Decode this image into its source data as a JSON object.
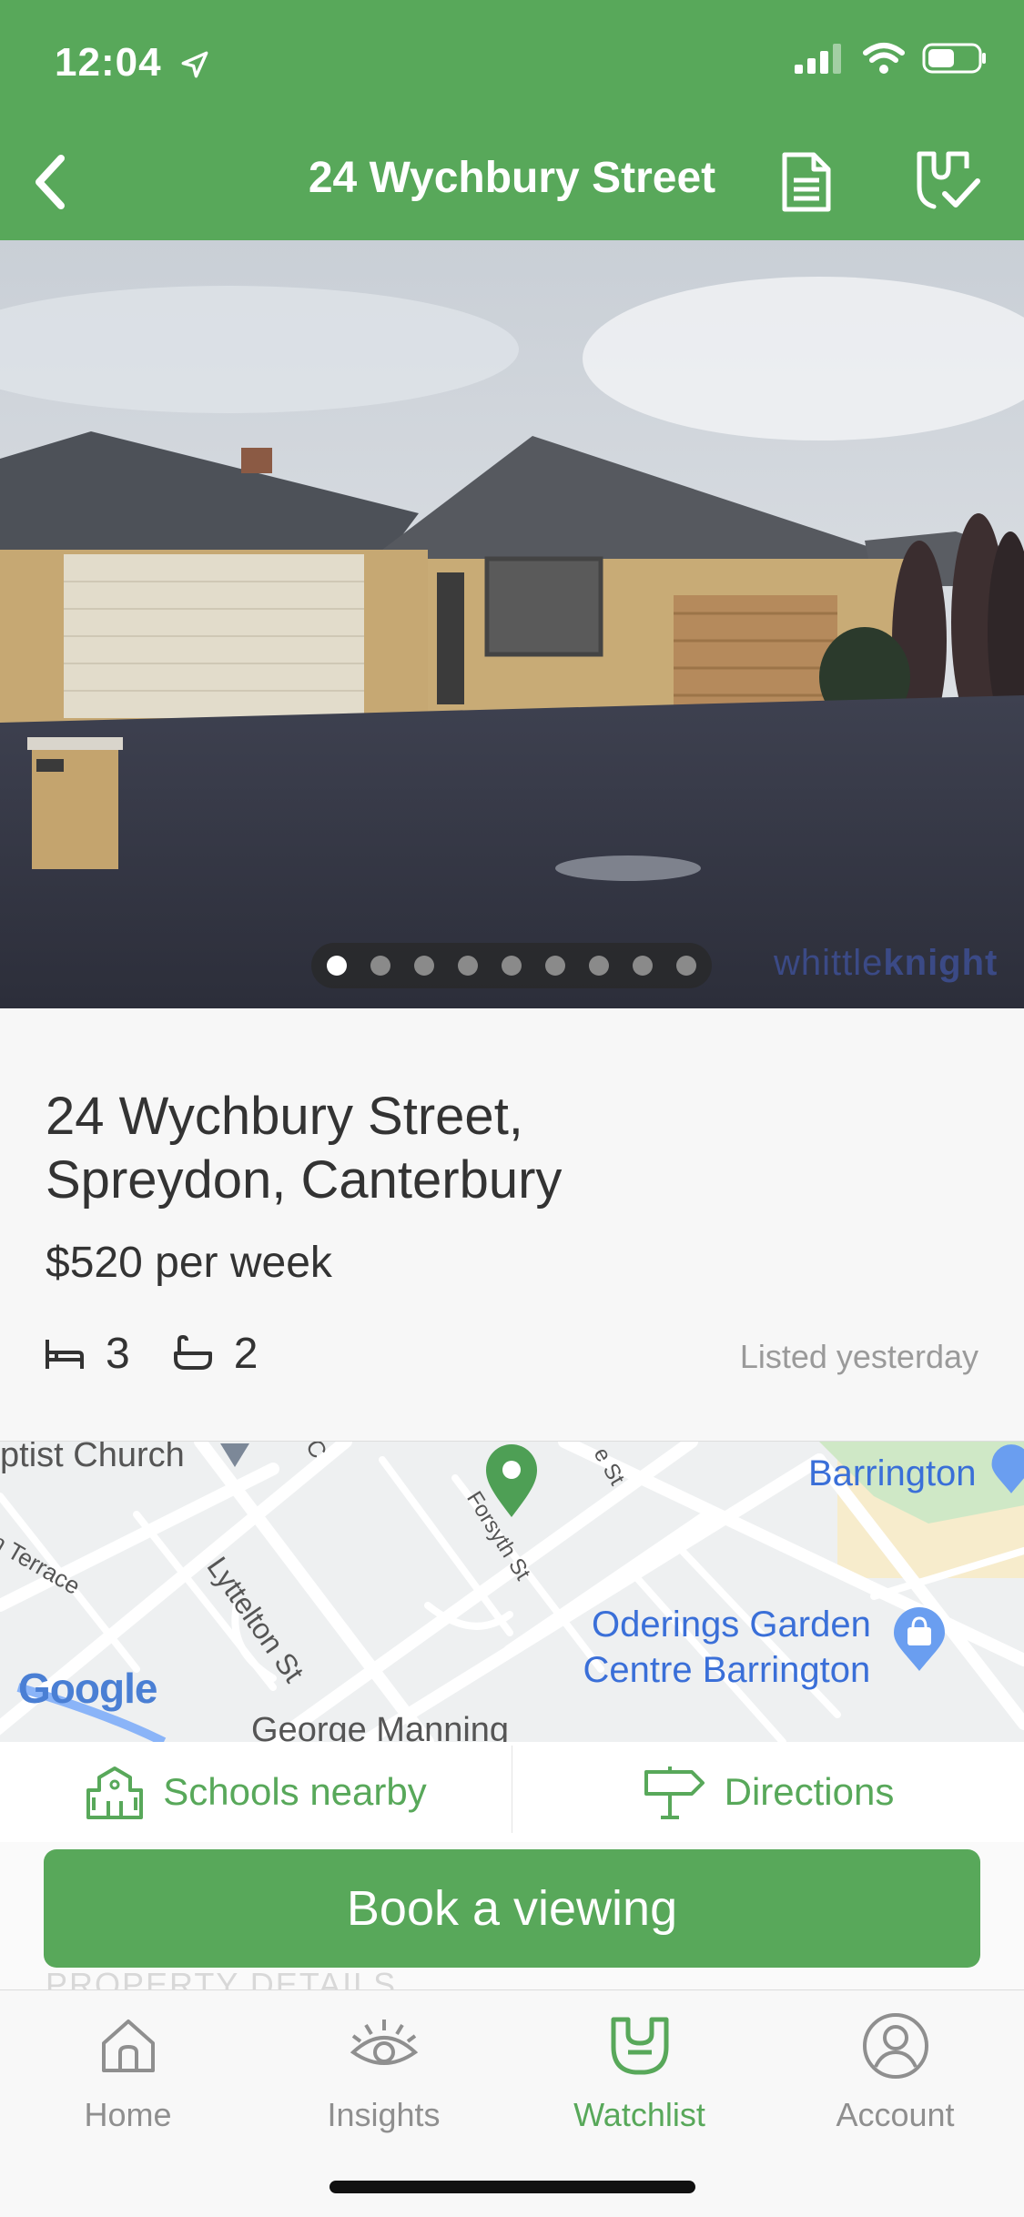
{
  "status_bar": {
    "time": "12:04"
  },
  "nav": {
    "title": "24 Wychbury Street"
  },
  "gallery": {
    "photo_count": 9,
    "active_index": 0,
    "watermark_light": "whittle",
    "watermark_bold": "knight"
  },
  "listing": {
    "address_line1": "24 Wychbury Street,",
    "address_line2": "Spreydon, Canterbury",
    "price": "$520 per week",
    "bedrooms": "3",
    "bathrooms": "2",
    "listed": "Listed yesterday"
  },
  "map": {
    "labels": {
      "church": "ptist Church",
      "lyttelton": "Lyttelton St",
      "forsyth": "Forsyth St",
      "terrace": "n Terrace",
      "e_st": "e St",
      "c": "C",
      "george": "George Manning",
      "barrington": "Barrington",
      "oderings_1": "Oderings Garden",
      "oderings_2": "Centre Barrington",
      "google": "Google"
    }
  },
  "actions": {
    "schools": "Schools nearby",
    "directions": "Directions",
    "book": "Book a viewing"
  },
  "section_peek": "PROPERTY DETAILS",
  "tabs": [
    {
      "label": "Home",
      "icon": "home-icon"
    },
    {
      "label": "Insights",
      "icon": "eye-icon"
    },
    {
      "label": "Watchlist",
      "icon": "watchlist-icon"
    },
    {
      "label": "Account",
      "icon": "account-icon"
    }
  ],
  "colors": {
    "brand_green": "#58a85a",
    "map_blue": "#3a6fd8"
  }
}
